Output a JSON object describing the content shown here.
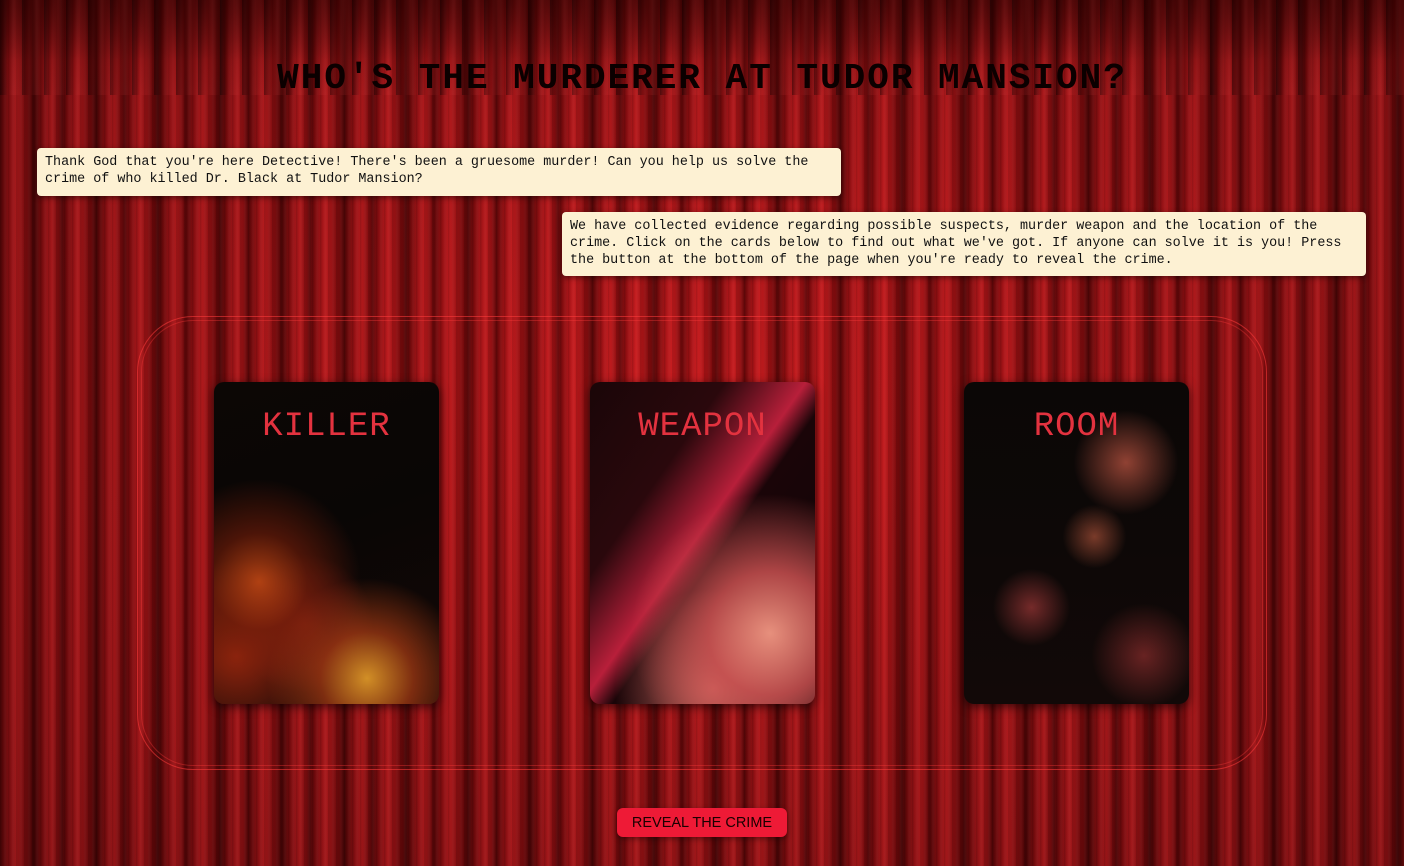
{
  "page": {
    "title": "WHO'S THE MURDERER AT TUDOR MANSION?"
  },
  "notes": [
    "Thank God that you're here Detective! There's been a gruesome murder! Can you help us solve the crime of who killed Dr. Black at Tudor Mansion?",
    "We have collected evidence regarding possible suspects, murder weapon and the location of the crime. Click on the cards below to find out what we've got. If anyone can solve it is you! Press the button at the bottom of the page when you're ready to reveal the crime."
  ],
  "cards": [
    {
      "label": "KILLER"
    },
    {
      "label": "WEAPON"
    },
    {
      "label": "ROOM"
    }
  ],
  "actions": {
    "reveal_label": "REVEAL THE CRIME"
  },
  "colors": {
    "curtain": "#a31215",
    "note_background": "#fdf1d3",
    "card_label": "#e3323f",
    "button": "#ee1a36"
  }
}
